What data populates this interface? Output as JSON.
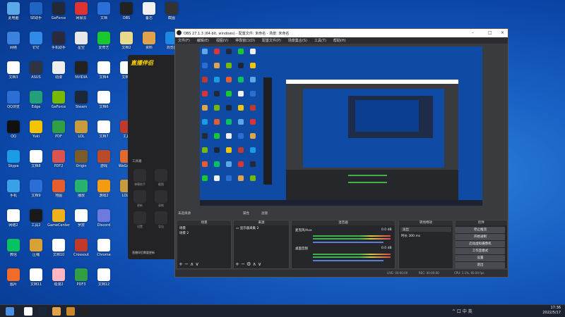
{
  "desktop": {
    "icons": [
      {
        "label": "此电脑",
        "color": "#5aa8e8"
      },
      {
        "label": "SE助手",
        "color": "#1f64c2"
      },
      {
        "label": "GeForce",
        "color": "#222a38"
      },
      {
        "label": "网易云",
        "color": "#d33"
      },
      {
        "label": "文档",
        "color": "#2b6fd6"
      },
      {
        "label": "OBS",
        "color": "#222"
      },
      {
        "label": "备忘",
        "color": "#f0f0f0"
      },
      {
        "label": "截图",
        "color": "#333"
      },
      {
        "label": "网络",
        "color": "#3b82e0"
      },
      {
        "label": "钉钉",
        "color": "#2f8ae8"
      },
      {
        "label": "手机助手",
        "color": "#2a2a3a"
      },
      {
        "label": "星空",
        "color": "#e8e8e8"
      },
      {
        "label": "爱奇艺",
        "color": "#18c82d"
      },
      {
        "label": "文档2",
        "color": "#e9d98b"
      },
      {
        "label": "资料",
        "color": "#e0a24b"
      },
      {
        "label": "浏览器",
        "color": "#1e88e5"
      },
      {
        "label": "文档3",
        "color": "#fff"
      },
      {
        "label": "ASUS",
        "color": "#2e3444"
      },
      {
        "label": "动漫",
        "color": "#eee"
      },
      {
        "label": "NVIDIA",
        "color": "#222"
      },
      {
        "label": "文档4",
        "color": "#fff"
      },
      {
        "label": "文档5",
        "color": "#fff"
      },
      {
        "label": "QQ浏览",
        "color": "#2b6fd6"
      },
      {
        "label": "Edge",
        "color": "#21a07a"
      },
      {
        "label": "GeForce",
        "color": "#76b900"
      },
      {
        "label": "Steam",
        "color": "#1b2838"
      },
      {
        "label": "文档6",
        "color": "#fff"
      },
      {
        "label": "QQ",
        "color": "#111"
      },
      {
        "label": "Yuki",
        "color": "#f4c400"
      },
      {
        "label": "PDF",
        "color": "#2f9e44"
      },
      {
        "label": "LOL",
        "color": "#c89b3c"
      },
      {
        "label": "文档7",
        "color": "#fff"
      },
      {
        "label": "工具",
        "color": "#c0392b"
      },
      {
        "label": "Skype",
        "color": "#1a9be6"
      },
      {
        "label": "文档8",
        "color": "#fff"
      },
      {
        "label": "PDF2",
        "color": "#d9534f"
      },
      {
        "label": "Origin",
        "color": "#7a5c2b"
      },
      {
        "label": "游戏",
        "color": "#b94a2a"
      },
      {
        "label": "WeGame",
        "color": "#e26a2c"
      },
      {
        "label": "手机",
        "color": "#3aa0e8"
      },
      {
        "label": "文档9",
        "color": "#2b6fd6"
      },
      {
        "label": "地图",
        "color": "#e85d2c"
      },
      {
        "label": "播放",
        "color": "#26b36e"
      },
      {
        "label": "游戏2",
        "color": "#f39c12"
      },
      {
        "label": "LOL2",
        "color": "#c89b3c"
      },
      {
        "label": "网络2",
        "color": "#fff"
      },
      {
        "label": "工具2",
        "color": "#1a1a1a"
      },
      {
        "label": "GameCenter",
        "color": "#efb21a"
      },
      {
        "label": "罗技",
        "color": "#fff"
      },
      {
        "label": "Discord",
        "color": "#6d7ae0"
      },
      {
        "label": "微信",
        "color": "#08c160"
      },
      {
        "label": "压缩",
        "color": "#d8a136"
      },
      {
        "label": "文档10",
        "color": "#fff"
      },
      {
        "label": "Crossout",
        "color": "#c0392b"
      },
      {
        "label": "Chrome",
        "color": "#fff"
      },
      {
        "label": "图片",
        "color": "#f26b2a"
      },
      {
        "label": "文档11",
        "color": "#fff"
      },
      {
        "label": "动漫2",
        "color": "#ffb6c1"
      },
      {
        "label": "PDF3",
        "color": "#2f9e44"
      },
      {
        "label": "文档12",
        "color": "#fff"
      }
    ]
  },
  "app": {
    "logo": "直播伴侣",
    "side_label": "工具箱",
    "tools": [
      "弹幕助手",
      "截图",
      "更新",
      "录制",
      "设置",
      "导出"
    ],
    "footer": "直播伴侣需要更新"
  },
  "obs": {
    "title": "OBS 27.1.3 (64-bit, windows) - 配置文件: 未命名 - 场景: 未命名",
    "menu": [
      "文件(F)",
      "编辑(E)",
      "视图(V)",
      "停靠窗口(D)",
      "配置文件(P)",
      "场景集合(S)",
      "工具(T)",
      "帮助(H)"
    ],
    "source_tab_label": "未选择源",
    "properties_label": "属性",
    "filters_label": "滤镜",
    "docks": {
      "scenes": {
        "title": "场景",
        "items": [
          "场景",
          "场景 2"
        ]
      },
      "sources": {
        "title": "来源",
        "items": [
          "显示器采集 2"
        ]
      },
      "mixer": {
        "title": "混音器",
        "channels": [
          {
            "name": "麦克风/Aux",
            "db": "0.0 dB"
          },
          {
            "name": "桌面音频",
            "db": "0.0 dB"
          }
        ]
      },
      "transitions": {
        "title": "转场特效",
        "type": "淡出",
        "duration_label": "时长",
        "duration": "300 ms"
      },
      "controls": {
        "title": "控件",
        "buttons": [
          "停止推流",
          "开始录制",
          "启动虚拟摄像机",
          "工作室模式",
          "设置",
          "退出"
        ]
      }
    },
    "status": {
      "live": "LIVE: 00:00:00",
      "rec": "REC: 00:00:00",
      "cpu": "CPU: 1.1%, 60.00 fps"
    }
  },
  "taskbar": {
    "apps": [
      "开始",
      "Chrome",
      "Steam",
      "文件",
      "工具",
      "OBS"
    ],
    "tray": "^ 口 中 英",
    "time": "17:36",
    "date": "2022/5/17"
  }
}
